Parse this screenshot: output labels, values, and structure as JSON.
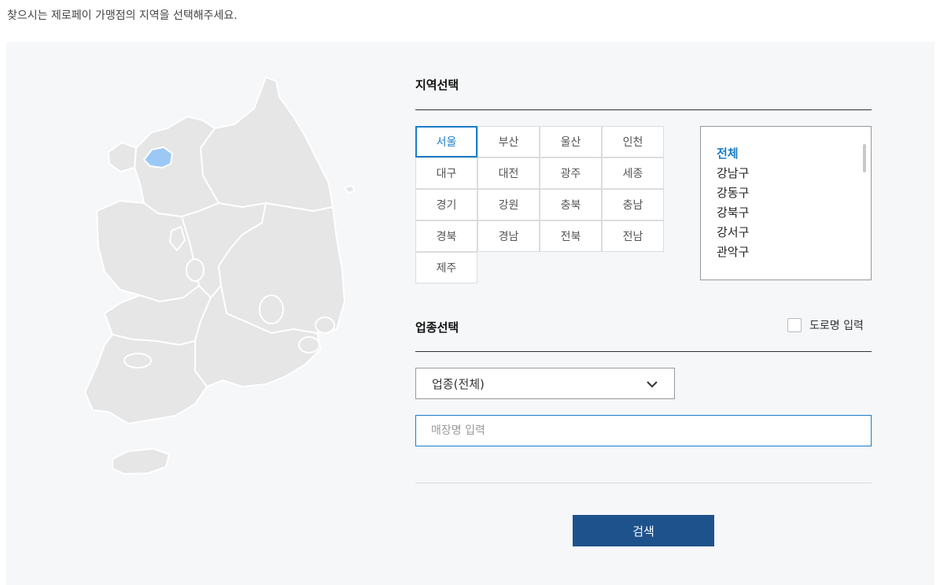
{
  "intro_text": "찾으시는 제로페이 가맹점의 지역을 선택해주세요.",
  "region_section": {
    "title": "지역선택",
    "regions": [
      "서울",
      "부산",
      "울산",
      "인천",
      "대구",
      "대전",
      "광주",
      "세종",
      "경기",
      "강원",
      "충북",
      "충남",
      "경북",
      "경남",
      "전북",
      "전남",
      "제주"
    ],
    "selected_region": "서울"
  },
  "districts": {
    "items": [
      "전체",
      "강남구",
      "강동구",
      "강북구",
      "강서구",
      "관악구"
    ],
    "selected": "전체"
  },
  "category_section": {
    "title": "업종선택",
    "road_name_label": "도로명 입력",
    "road_name_checked": false,
    "category_select_value": "업종(전체)",
    "store_name_placeholder": "매장명 입력",
    "store_name_value": ""
  },
  "search_button_label": "검색",
  "colors": {
    "accent": "#1b7cc7",
    "button": "#1e528c",
    "map_land": "#e6e6e6",
    "map_highlight": "#9cc8f6",
    "panel_bg": "#f6f7f9"
  }
}
